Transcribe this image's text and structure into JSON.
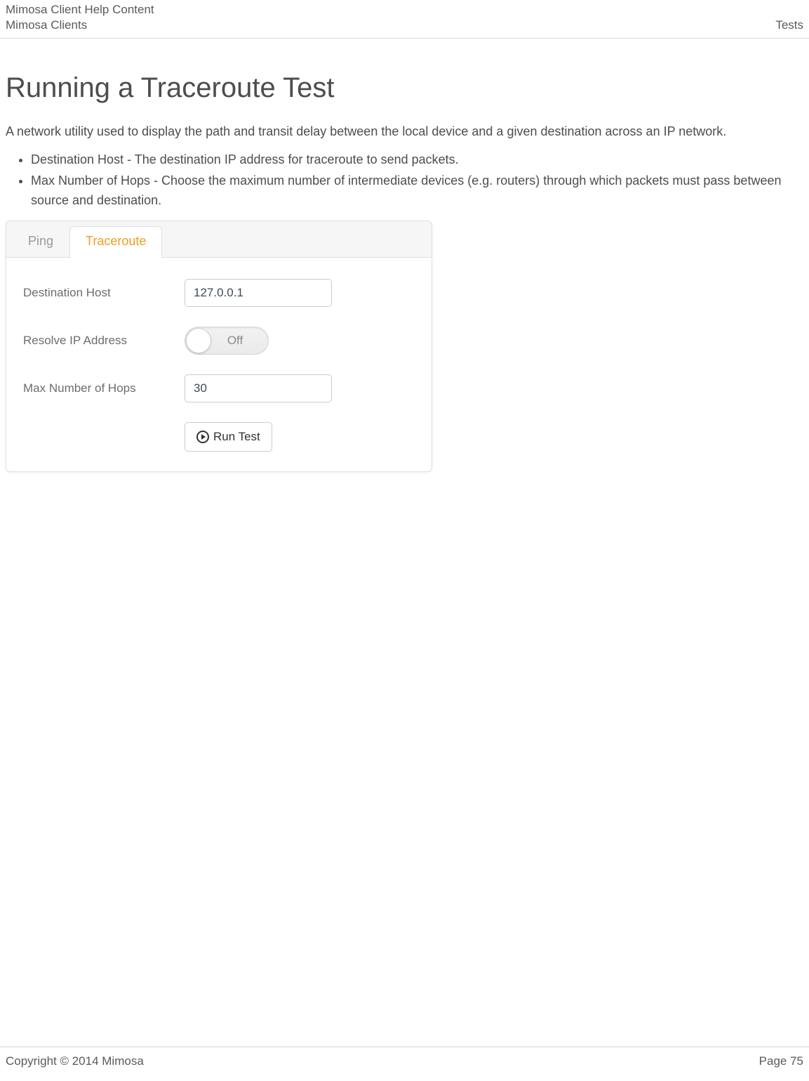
{
  "header": {
    "line1": "Mimosa Client Help Content",
    "line2_left": "Mimosa Clients",
    "line2_right": "Tests"
  },
  "page": {
    "title": "Running a Traceroute Test",
    "intro": "A network utility used to display the path and transit delay between the local device and a given destination across an IP network.",
    "bullets": [
      "Destination Host - The destination IP address for traceroute to send packets.",
      "Max Number of Hops - Choose the maximum number of intermediate devices (e.g. routers) through which packets must pass between source and destination."
    ]
  },
  "panel": {
    "tabs": {
      "ping": "Ping",
      "traceroute": "Traceroute",
      "active": "traceroute"
    },
    "fields": {
      "destination_host": {
        "label": "Destination Host",
        "value": "127.0.0.1"
      },
      "resolve_ip": {
        "label": "Resolve IP Address",
        "state": "Off"
      },
      "max_hops": {
        "label": "Max Number of Hops",
        "value": "30"
      }
    },
    "run_label": "Run Test"
  },
  "footer": {
    "copyright": "Copyright © 2014 Mimosa",
    "page": "Page 75"
  }
}
